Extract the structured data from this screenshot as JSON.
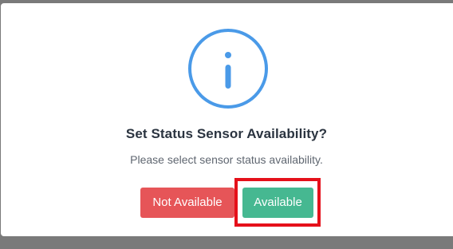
{
  "dialog": {
    "title": "Set Status Sensor Availability?",
    "message": "Please select sensor status availability.",
    "icon": "info-icon",
    "colors": {
      "icon": "#4a9ae8",
      "backdrop": "#7a7a7a",
      "title_text": "#2b3440",
      "message_text": "#5f6670"
    }
  },
  "buttons": {
    "not_available_label": "Not Available",
    "not_available_color": "#e65558",
    "available_label": "Available",
    "available_color": "#46b891"
  },
  "annotation": {
    "highlight_color": "#e5101a",
    "highlighted_element": "available-button"
  }
}
